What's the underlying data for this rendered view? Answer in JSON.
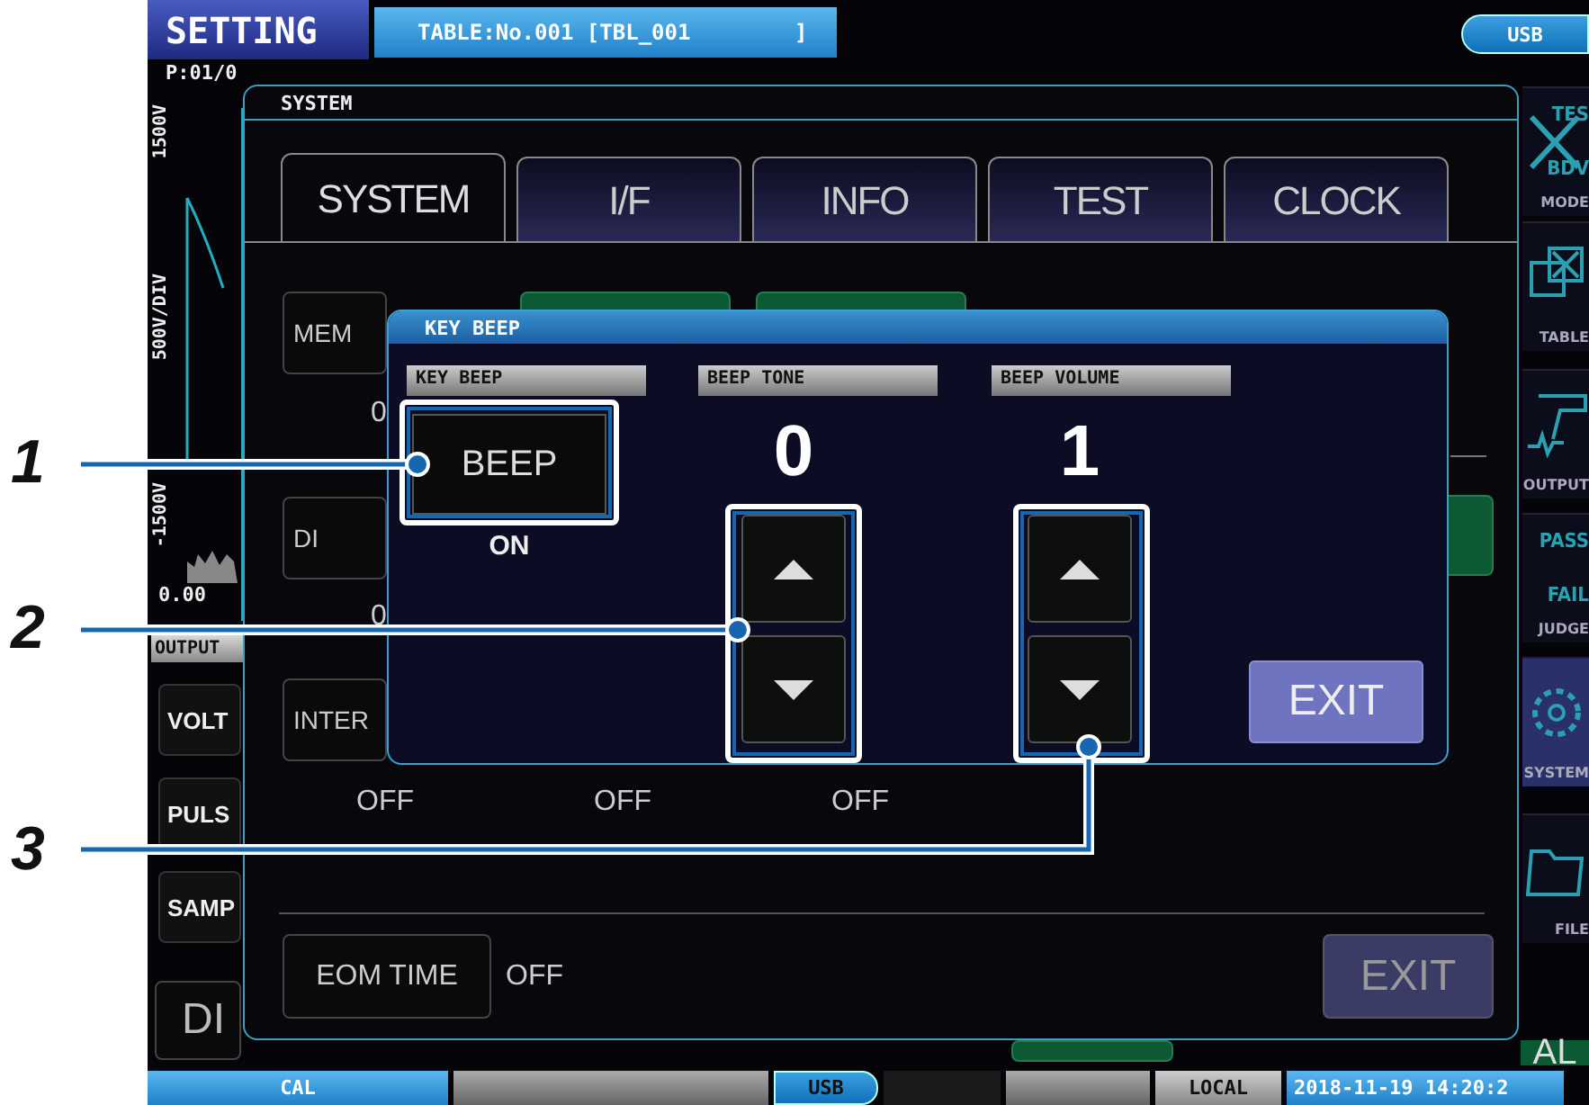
{
  "header": {
    "title": "SETTING",
    "table_label": "TABLE:No.001 [TBL_001        ]",
    "usb": "USB"
  },
  "background": {
    "page_label": "P:01/0",
    "axis_labels": [
      "1500V",
      "500V/DIV",
      "-1500V"
    ],
    "x_start": "0.00",
    "output_label": "OUTPUT",
    "buttons": [
      "VOLT",
      "PULS",
      "SAMP"
    ],
    "bottom_button": "DI",
    "right_button": "AL"
  },
  "sidebar": {
    "items": [
      {
        "kind": "mode",
        "label": "MODE",
        "art": [
          "TES",
          "BDV"
        ],
        "selected": false
      },
      {
        "kind": "table",
        "label": "TABLE",
        "selected": false
      },
      {
        "kind": "output",
        "label": "OUTPUT",
        "selected": false
      },
      {
        "kind": "judge",
        "label": "JUDGE",
        "art": [
          "PASS",
          "FAIL"
        ],
        "selected": false
      },
      {
        "kind": "system",
        "label": "SYSTEM",
        "selected": true
      },
      {
        "kind": "file",
        "label": "FILE",
        "selected": false
      }
    ]
  },
  "status_bar": {
    "cal": "CAL",
    "usb": "USB",
    "local": "LOCAL",
    "datetime": "2018-11-19 14:20:2"
  },
  "system_window": {
    "title": "SYSTEM",
    "tabs": [
      {
        "label": "SYSTEM",
        "selected": true
      },
      {
        "label": "I/F",
        "selected": false
      },
      {
        "label": "INFO",
        "selected": false
      },
      {
        "label": "TEST",
        "selected": false
      },
      {
        "label": "CLOCK",
        "selected": false
      }
    ],
    "buttons": [
      {
        "label": "MEM",
        "value": "0"
      },
      {
        "label": "DI",
        "value": "0"
      },
      {
        "label": "INTER",
        "value": "OFF"
      }
    ],
    "other_values": [
      "OFF",
      "OFF"
    ],
    "eom": {
      "label": "EOM TIME",
      "value": "OFF"
    },
    "exit": "EXIT"
  },
  "key_beep": {
    "title": "KEY BEEP",
    "columns": [
      {
        "kind": "toggle",
        "header": "KEY BEEP",
        "button": "BEEP",
        "value": "ON"
      },
      {
        "kind": "stepper",
        "header": "BEEP TONE",
        "value": "0"
      },
      {
        "kind": "stepper",
        "header": "BEEP VOLUME",
        "value": "1"
      }
    ],
    "exit": "EXIT"
  },
  "callouts": [
    {
      "number": "1"
    },
    {
      "number": "2"
    },
    {
      "number": "3"
    }
  ]
}
